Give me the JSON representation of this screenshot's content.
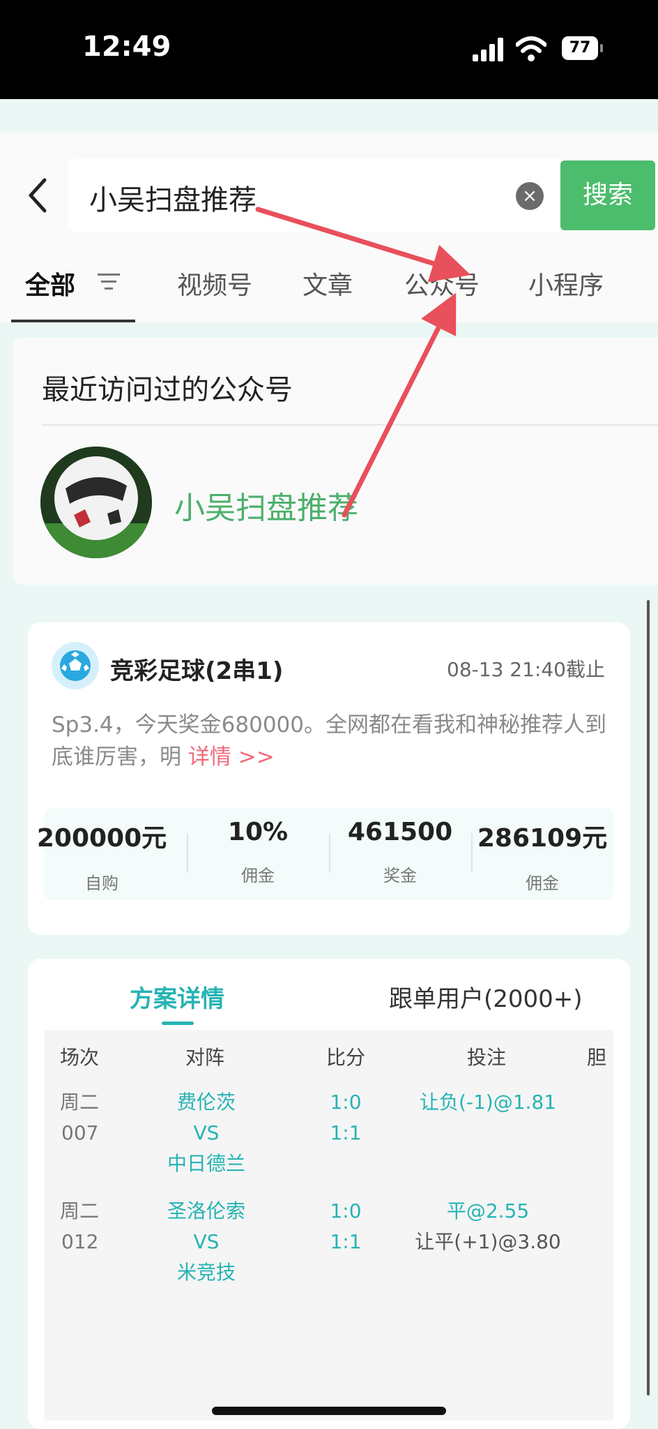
{
  "status_bar": {
    "time": "12:49",
    "battery": "77"
  },
  "search": {
    "query": "小吴扫盘推荐",
    "button_label": "搜索"
  },
  "tabs": [
    "全部",
    "视频号",
    "文章",
    "公众号",
    "小程序"
  ],
  "recent": {
    "title": "最近访问过的公众号",
    "account_name": "小吴扫盘推荐"
  },
  "lottery": {
    "title": "竞彩足球(2串1)",
    "deadline": "08-13 21:40截止",
    "description": "Sp3.4，今天奖金680000。全网都在看我和神秘推荐人到底谁厉害，明",
    "detail_link": "详情 >>",
    "stats": [
      {
        "value": "200000元",
        "label": "自购"
      },
      {
        "value": "10%",
        "label": "佣金"
      },
      {
        "value": "461500",
        "label": "奖金"
      },
      {
        "value": "286109元",
        "label": "佣金"
      }
    ]
  },
  "plan": {
    "tab_active": "方案详情",
    "tab_followers": "跟单用户(2000+)",
    "headers": [
      "场次",
      "对阵",
      "比分",
      "投注",
      "胆"
    ],
    "rows": [
      {
        "day": "周二",
        "num": "007",
        "home": "费伦茨",
        "vs": "VS",
        "away": "中日德兰",
        "score1": "1:0",
        "score2": "1:1",
        "bet1": "让负(-1)@1.81",
        "bet2": ""
      },
      {
        "day": "周二",
        "num": "012",
        "home": "圣洛伦索",
        "vs": "VS",
        "away": "米竞技",
        "score1": "1:0",
        "score2": "1:1",
        "bet1": "平@2.55",
        "bet2": "让平(+1)@3.80"
      }
    ]
  },
  "colors": {
    "accent_green": "#4cbd6c",
    "accent_teal": "#27b3b3",
    "link_pink": "#f06a7a",
    "arrow_red": "#e8505b"
  }
}
